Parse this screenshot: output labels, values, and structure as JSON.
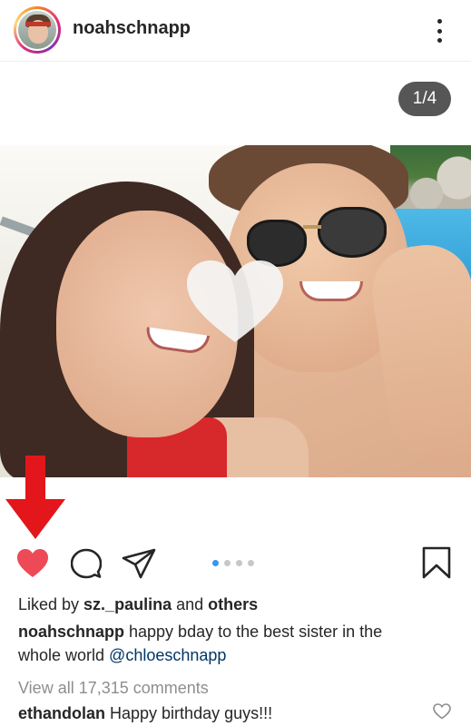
{
  "header": {
    "username": "noahschnapp"
  },
  "carousel": {
    "counter": "1/4",
    "dots_total": 4,
    "dots_active_index": 0
  },
  "colors": {
    "like_red": "#ed4956",
    "arrow_red": "#e3161b",
    "dot_active": "#3897f0",
    "mention_blue": "#003569"
  },
  "icons": {
    "more": "more-vertical-icon",
    "like": "heart-filled-icon",
    "comment": "comment-bubble-icon",
    "share": "paper-plane-icon",
    "save": "bookmark-icon",
    "comment_like": "heart-outline-icon"
  },
  "likes": {
    "prefix": "Liked by ",
    "user": "sz._paulina",
    "middle": " and ",
    "others": "others"
  },
  "caption": {
    "author": "noahschnapp",
    "text1": " happy bday to the best sister in the",
    "text2": "whole world ",
    "mention": "@chloeschnapp"
  },
  "comments": {
    "view_all": "View all 17,315 comments",
    "first": {
      "author": "ethandolan",
      "text": " Happy birthday guys!!!"
    }
  }
}
